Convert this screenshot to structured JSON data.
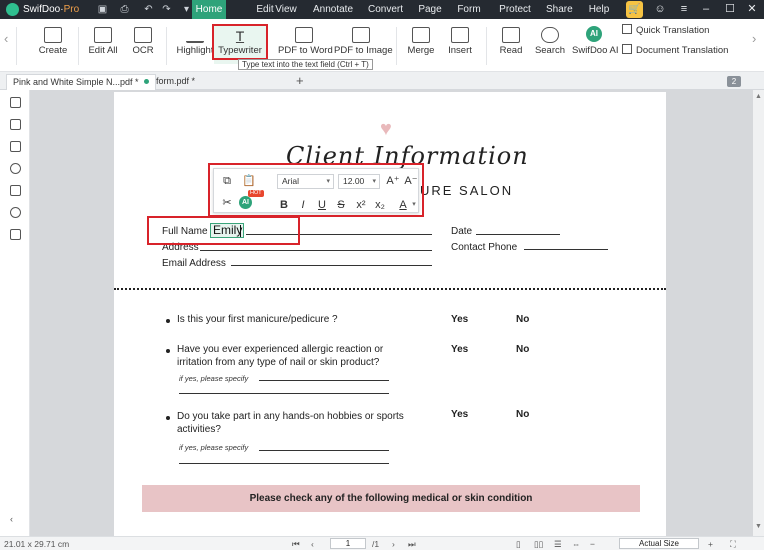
{
  "titlebar": {
    "app_name": "SwifDoo",
    "app_suffix": "Pro",
    "menus": [
      "Home",
      "Edit",
      "View",
      "Annotate",
      "Convert",
      "Page",
      "Form",
      "Protect",
      "Share",
      "Help"
    ],
    "active_menu": "Home",
    "accent": "#2ea37a"
  },
  "ribbon": {
    "create": "Create",
    "edit_all": "Edit All",
    "ocr": "OCR",
    "highlight": "Highlight",
    "typewriter": "Typewriter",
    "pdf_to_word": "PDF to Word",
    "pdf_to_image": "PDF to Image",
    "merge": "Merge",
    "insert": "Insert",
    "read": "Read",
    "search": "Search",
    "swifdoo_ai": "SwifDoo AI",
    "ai_badge": "AI",
    "quick_translation": "Quick Translation",
    "document_translation": "Document Translation"
  },
  "tooltip": "Type text into the text field (Ctrl + T)",
  "tabs": [
    {
      "label": "Pink and White Simple N...pdf *"
    },
    {
      "label": "form.pdf *"
    }
  ],
  "page_count_badge": "2",
  "floating_toolbar": {
    "font": "Arial",
    "size": "12.00",
    "ai": "AI",
    "hot": "HOT"
  },
  "document": {
    "title": "Client Information",
    "subtitle": "URE SALON",
    "full_name_label": "Full Name",
    "full_name_value": "Emily",
    "address_label": "Address",
    "email_label": "Email Address",
    "date_label": "Date",
    "contact_label": "Contact Phone",
    "q1": "Is this your first manicure/pedicure ?",
    "q2": "Have you ever experienced allergic reaction or irritation from any type of nail or skin product?",
    "q2_note": "if yes, please specify",
    "q3": "Do you take part in any hands-on hobbies or sports activities?",
    "q3_note": "if yes, please specify",
    "yes": "Yes",
    "no": "No",
    "banner": "Please check any of the following medical or skin condition"
  },
  "status": {
    "page_size": "21.01 x 29.71 cm",
    "current_page": "1",
    "total_pages": "/1",
    "zoom": "Actual Size"
  }
}
